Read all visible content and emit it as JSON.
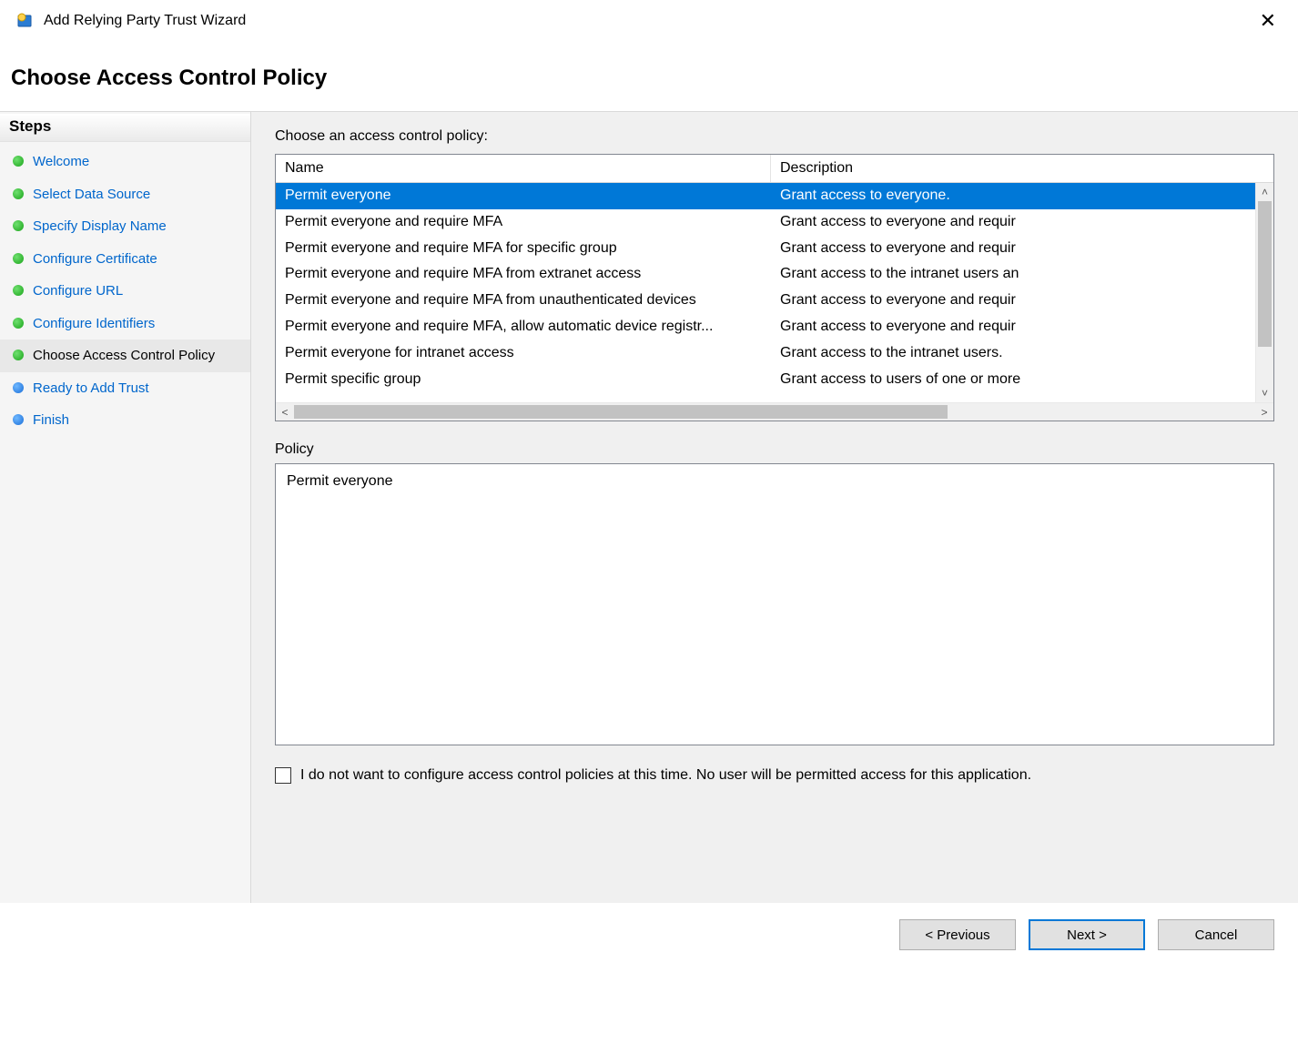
{
  "window": {
    "title": "Add Relying Party Trust Wizard"
  },
  "heading": "Choose Access Control Policy",
  "sidebar": {
    "header": "Steps",
    "items": [
      {
        "label": "Welcome",
        "state": "done"
      },
      {
        "label": "Select Data Source",
        "state": "done"
      },
      {
        "label": "Specify Display Name",
        "state": "done"
      },
      {
        "label": "Configure Certificate",
        "state": "done"
      },
      {
        "label": "Configure URL",
        "state": "done"
      },
      {
        "label": "Configure Identifiers",
        "state": "done"
      },
      {
        "label": "Choose Access Control Policy",
        "state": "current"
      },
      {
        "label": "Ready to Add Trust",
        "state": "pending"
      },
      {
        "label": "Finish",
        "state": "pending"
      }
    ]
  },
  "main": {
    "list_label": "Choose an access control policy:",
    "columns": {
      "name": "Name",
      "description": "Description"
    },
    "policies": [
      {
        "name": "Permit everyone",
        "description": "Grant access to everyone.",
        "selected": true
      },
      {
        "name": "Permit everyone and require MFA",
        "description": "Grant access to everyone and requir"
      },
      {
        "name": "Permit everyone and require MFA for specific group",
        "description": "Grant access to everyone and requir"
      },
      {
        "name": "Permit everyone and require MFA from extranet access",
        "description": "Grant access to the intranet users an"
      },
      {
        "name": "Permit everyone and require MFA from unauthenticated devices",
        "description": "Grant access to everyone and requir"
      },
      {
        "name": "Permit everyone and require MFA, allow automatic device registr...",
        "description": "Grant access to everyone and requir"
      },
      {
        "name": "Permit everyone for intranet access",
        "description": "Grant access to the intranet users."
      },
      {
        "name": "Permit specific group",
        "description": "Grant access to users of one or more"
      }
    ],
    "policy_label": "Policy",
    "policy_detail": "Permit everyone",
    "checkbox_label": "I do not want to configure access control policies at this time. No user will be permitted access for this application.",
    "checkbox_checked": false
  },
  "buttons": {
    "previous": "< Previous",
    "next": "Next >",
    "cancel": "Cancel"
  }
}
